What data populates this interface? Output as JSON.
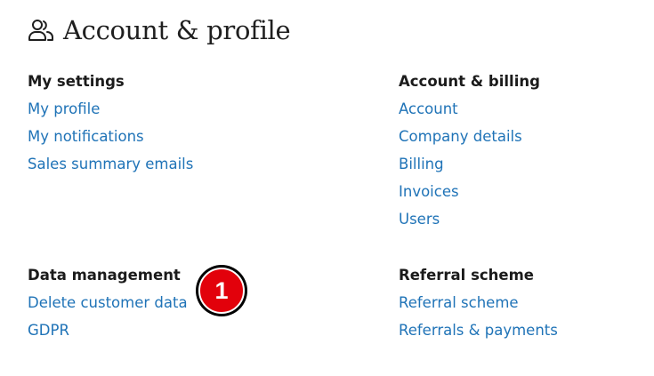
{
  "header": {
    "title": "Account & profile",
    "icon": "users-icon"
  },
  "sections": {
    "my_settings": {
      "heading": "My settings",
      "links": [
        "My profile",
        "My notifications",
        "Sales summary emails"
      ]
    },
    "account_billing": {
      "heading": "Account & billing",
      "links": [
        "Account",
        "Company details",
        "Billing",
        "Invoices",
        "Users"
      ]
    },
    "data_management": {
      "heading": "Data management",
      "links": [
        "Delete customer data",
        "GDPR"
      ]
    },
    "referral_scheme": {
      "heading": "Referral scheme",
      "links": [
        "Referral scheme",
        "Referrals & payments"
      ]
    }
  },
  "annotation": {
    "step_number": "1"
  },
  "colors": {
    "link": "#1f73b7",
    "heading": "#1b1b1b",
    "badge": "#e2010b"
  }
}
